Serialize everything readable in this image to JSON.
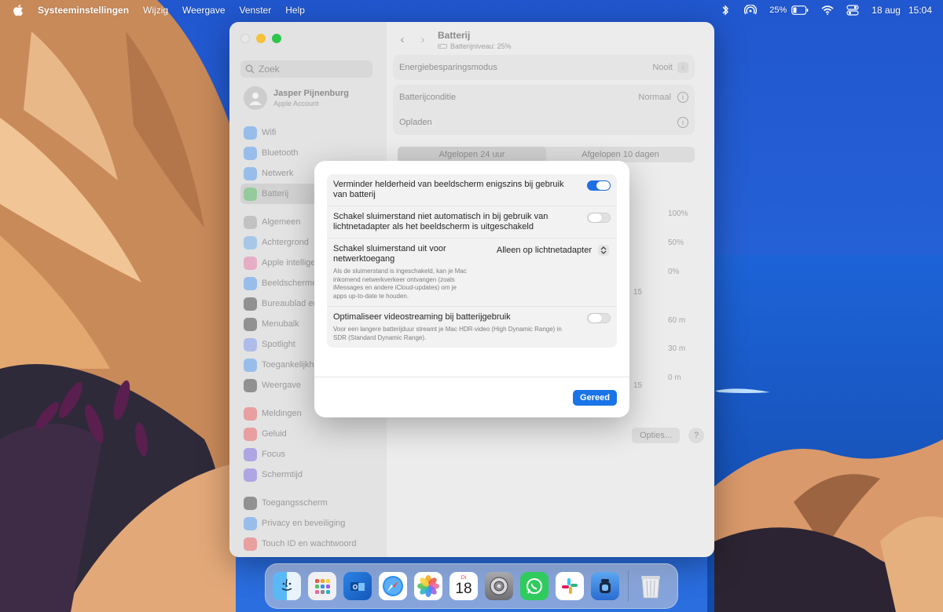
{
  "menubar": {
    "app": "Systeeminstellingen",
    "menus": [
      "Wijzig",
      "Weergave",
      "Venster",
      "Help"
    ],
    "battery_percent": "25%",
    "date": "18 aug",
    "time": "15:04"
  },
  "sidebar": {
    "search_placeholder": "Zoek",
    "account_name": "Jasper Pijnenburg",
    "account_sub": "Apple Account",
    "items": [
      {
        "label": "Wifi",
        "color": "#3b8df1"
      },
      {
        "label": "Bluetooth",
        "color": "#3b8df1"
      },
      {
        "label": "Netwerk",
        "color": "#3b8df1"
      },
      {
        "label": "Batterij",
        "color": "#4cc25a",
        "active": true
      },
      {
        "label": "Algemeen",
        "color": "#9a9a9a"
      },
      {
        "label": "Achtergrond",
        "color": "#5aa7e8"
      },
      {
        "label": "Apple intellige",
        "color": "#e86aa0"
      },
      {
        "label": "Beeldscherme",
        "color": "#3b8df1"
      },
      {
        "label": "Bureaublad en",
        "color": "#2c2c2c"
      },
      {
        "label": "Menubalk",
        "color": "#2c2c2c"
      },
      {
        "label": "Spotlight",
        "color": "#6a8cf0"
      },
      {
        "label": "Toegankelijkh",
        "color": "#3b8df1"
      },
      {
        "label": "Weergave",
        "color": "#2c2c2c"
      },
      {
        "label": "Meldingen",
        "color": "#ef4b4b"
      },
      {
        "label": "Geluid",
        "color": "#ef4b4b"
      },
      {
        "label": "Focus",
        "color": "#6a5cdf"
      },
      {
        "label": "Schermtijd",
        "color": "#6a5cdf"
      },
      {
        "label": "Toegangsscherm",
        "color": "#2c2c2c"
      },
      {
        "label": "Privacy en beveiliging",
        "color": "#3b8df1"
      },
      {
        "label": "Touch ID en wachtwoord",
        "color": "#ef4b4b"
      }
    ]
  },
  "main": {
    "title": "Batterij",
    "subtitle": "Batterijniveau: 25%",
    "energy_label": "Energiebesparingsmodus",
    "energy_value": "Nooit",
    "condition_label": "Batterijconditie",
    "condition_value": "Normaal",
    "charging_label": "Opladen",
    "tab_24h": "Afgelopen 24 uur",
    "tab_10d": "Afgelopen 10 dagen",
    "axis_100": "100%",
    "axis_50": "50%",
    "axis_0": "0%",
    "axis_60m": "60 m",
    "axis_30m": "30 m",
    "axis_0m": "0 m",
    "tick_15a": "15",
    "tick_15b": "15",
    "options_button": "Opties...",
    "help_button": "?"
  },
  "sheet": {
    "options": [
      {
        "title": "Verminder helderheid van beeldscherm enigszins bij gebruik van batterij",
        "on": true
      },
      {
        "title": "Schakel sluimerstand niet automatisch in bij gebruik van lichtnetadapter als het beeldscherm is uitgeschakeld",
        "on": false
      }
    ],
    "network": {
      "title": "Schakel sluimerstand uit voor netwerktoegang",
      "value": "Alleen op lichtnetadapter",
      "desc": "Als de sluimerstand is ingeschakeld, kan je Mac inkomend netwerkverkeer ontvangen (zoals iMessages en andere iCloud-updates) om je apps up-to-date te houden."
    },
    "video": {
      "title": "Optimaliseer videostreaming bij batterijgebruik",
      "desc": "Voor een langere batterijduur streamt je Mac HDR-video (High Dynamic Range) in SDR (Standard Dynamic Range).",
      "on": false
    },
    "done_label": "Gereed"
  },
  "dock": {
    "calendar_day": "Di",
    "calendar_date": "18",
    "apps": [
      "finder-icon",
      "launchpad-icon",
      "outlook-icon",
      "safari-icon",
      "photos-icon",
      "calendar-icon",
      "system-settings-icon",
      "whatsapp-icon",
      "slack-icon",
      "jar-app-icon",
      "trash-icon"
    ]
  }
}
